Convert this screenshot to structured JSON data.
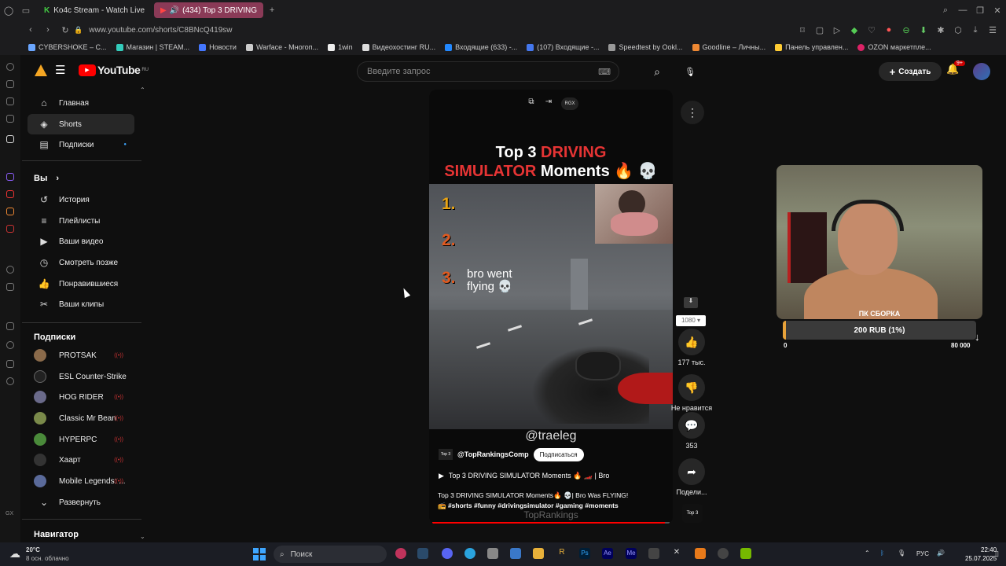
{
  "browser": {
    "tabs": [
      {
        "label": "Ko4c Stream - Watch Live"
      },
      {
        "label": "(434) Top 3 DRIVING"
      }
    ],
    "url": "www.youtube.com/shorts/C8BNcQ419sw",
    "bookmarks": [
      "CYBERSHOKE – C...",
      "Магазин | STEAM...",
      "Новости",
      "Warface - Многоп...",
      "1win",
      "Видеохостинг RU...",
      "Входящие (633) -...",
      "(107) Входящие -...",
      "Speedtest by Ookl...",
      "Goodline – Личны...",
      "Панель управлен...",
      "OZON маркетпле..."
    ]
  },
  "youtube": {
    "logo": "YouTube",
    "logo_region": "RU",
    "search_placeholder": "Введите запрос",
    "create_label": "Создать",
    "notif_count": "9+",
    "sidebar": {
      "main": [
        "Главная",
        "Shorts",
        "Подписки"
      ],
      "you_title": "Вы",
      "you": [
        "История",
        "Плейлисты",
        "Ваши видео",
        "Смотреть позже",
        "Понравившиеся",
        "Ваши клипы"
      ],
      "subs_title": "Подписки",
      "subs": [
        "PROTSAK",
        "ESL Counter-Strike",
        "HOG RIDER",
        "Classic Mr Bean",
        "HYPERPC",
        "Хаарт",
        "Mobile Legends: ..."
      ],
      "expand": "Развернуть",
      "navigator": "Навигатор"
    },
    "short": {
      "title_line1_white": "Top 3 ",
      "title_line1_accent": "DRIVING",
      "title_line2_accent": "SIMULATOR",
      "title_line2_white": " Moments 🔥 💀",
      "ranks": [
        "1.",
        "2.",
        "3."
      ],
      "overlay_line1": "bro went",
      "overlay_line2": "flying 💀",
      "watermark": "@traeleg",
      "channel": "@TopRankingsComp",
      "channel_logo": "Top 3",
      "subscribe": "Подписаться",
      "playlist": "Top 3 DRIVING SIMULATOR Moments 🔥 🏎️ | Bro",
      "desc_line1": "Top 3 DRIVING SIMULATOR Moments🔥 💀| Bro Was FLYING!",
      "desc_line2": "📻 #shorts #funny #drivingsimulator #gaming #moments",
      "ghost_text": "TopRankings",
      "progress": 0.98,
      "top_badge": "RGX"
    },
    "actions": {
      "quality": "1080",
      "likes": "177 тыс.",
      "dislike": "Не нравится",
      "comments": "353",
      "share": "Подели..."
    }
  },
  "stream_overlay": {
    "label": "ПК СБОРКА",
    "amount": "200 RUB (1%)",
    "min": "0",
    "max": "80 000",
    "progress": 0.01
  },
  "taskbar": {
    "temp": "20°C",
    "weather": "8 осн. облачно",
    "search": "Поиск",
    "lang": "РУС",
    "time": "22:40",
    "date": "25.07.2025"
  },
  "colors": {
    "accent": "#e9a313",
    "brand_red": "#ff0000",
    "tab_active": "#8a3a57"
  }
}
